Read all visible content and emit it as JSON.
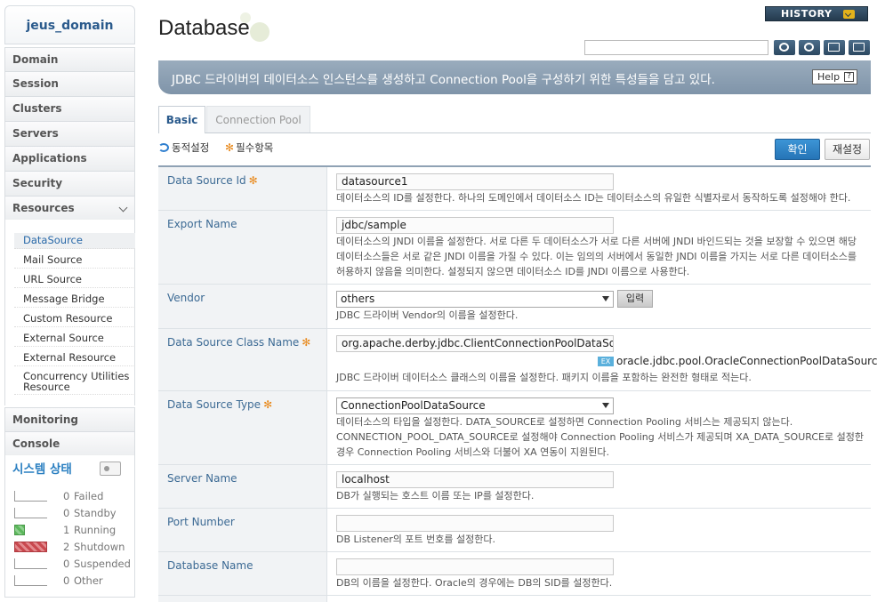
{
  "sidebar": {
    "domain": "jeus_domain",
    "menu": [
      "Domain",
      "Session",
      "Clusters",
      "Servers",
      "Applications",
      "Security",
      "Resources"
    ],
    "resources_sub": [
      "DataSource",
      "Mail Source",
      "URL Source",
      "Message Bridge",
      "Custom Resource",
      "External Source",
      "External Resource",
      "Concurrency Utilities Resource"
    ],
    "menu_bottom": [
      "Monitoring",
      "Console"
    ],
    "status_title": "시스템 상태",
    "status": [
      {
        "count": "0",
        "label": "Failed"
      },
      {
        "count": "0",
        "label": "Standby"
      },
      {
        "count": "1",
        "label": "Running"
      },
      {
        "count": "2",
        "label": "Shutdown"
      },
      {
        "count": "0",
        "label": "Suspended"
      },
      {
        "count": "0",
        "label": "Other"
      }
    ]
  },
  "header": {
    "title": "Database",
    "history": "HISTORY",
    "search_value": "",
    "banner": "JDBC 드라이버의 데이터소스 인스턴스를 생성하고 Connection Pool을 구성하기 위한 특성들을 담고 있다.",
    "help": "Help"
  },
  "tabs": [
    "Basic",
    "Connection Pool"
  ],
  "legend": {
    "dynamic": "동적설정",
    "required": "필수항목"
  },
  "buttons": {
    "ok": "확인",
    "reset": "재설정",
    "input": "입력"
  },
  "form": {
    "datasource_id": {
      "label": "Data Source Id",
      "value": "datasource1",
      "desc": "데이터소스의 ID를 설정한다. 하나의 도메인에서 데이터소스 ID는 데이터소스의 유일한 식별자로서 동작하도록 설정해야 한다."
    },
    "export_name": {
      "label": "Export Name",
      "value": "jdbc/sample",
      "desc": "데이터소스의 JNDI 이름을 설정한다. 서로 다른 두 데이터소스가 서로 다른 서버에 JNDI 바인드되는 것을 보장할 수 있으면 해당 데이터소스들은 서로 같은 JNDI 이름을 가질 수 있다. 이는 임의의 서버에서 동일한 JNDI 이름을 가지는 서로 다른 데이터소스를 허용하지 않음을 의미한다. 설정되지 않으면 데이터소스 ID를 JNDI 이름으로 사용한다."
    },
    "vendor": {
      "label": "Vendor",
      "value": "others",
      "desc": "JDBC 드라이버 Vendor의 이름을 설정한다."
    },
    "class_name": {
      "label": "Data Source Class Name",
      "value": "org.apache.derby.jdbc.ClientConnectionPoolDataSource",
      "example_badge": "EX",
      "example": "oracle.jdbc.pool.OracleConnectionPoolDataSource",
      "desc": "JDBC 드라이버 데이터소스 클래스의 이름을 설정한다. 패키지 이름을 포함하는 완전한 형태로 적는다."
    },
    "ds_type": {
      "label": "Data Source Type",
      "value": "ConnectionPoolDataSource",
      "desc": "데이터소스의 타입을 설정한다. DATA_SOURCE로 설정하면 Connection Pooling 서비스는 제공되지 않는다. CONNECTION_POOL_DATA_SOURCE로 설정해야 Connection Pooling 서비스가 제공되며 XA_DATA_SOURCE로 설정한 경우 Connection Pooling 서비스와 더불어 XA 연동이 지원된다."
    },
    "server_name": {
      "label": "Server Name",
      "value": "localhost",
      "desc": "DB가 실행되는 호스트 이름 또는 IP를 설정한다."
    },
    "port_number": {
      "label": "Port Number",
      "value": "",
      "desc": "DB Listener의 포트 번호를 설정한다."
    },
    "database_name": {
      "label": "Database Name",
      "value": "",
      "desc": "DB의 이름을 설정한다. Oracle의 경우에는 DB의 SID를 설정한다."
    }
  }
}
